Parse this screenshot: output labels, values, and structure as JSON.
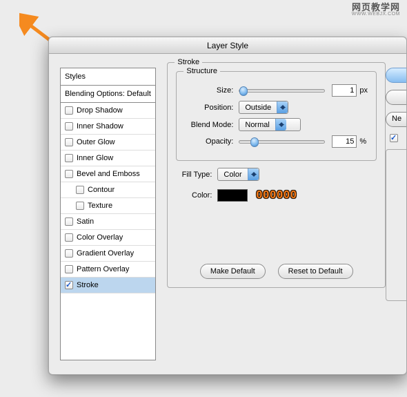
{
  "watermark": {
    "cn": "网页教学网",
    "en": "WWW.WEBJX.COM"
  },
  "dialog": {
    "title": "Layer Style",
    "sidebar": {
      "header": "Styles",
      "subheader": "Blending Options: Default",
      "items": [
        {
          "label": "Drop Shadow",
          "checked": false,
          "indent": false
        },
        {
          "label": "Inner Shadow",
          "checked": false,
          "indent": false
        },
        {
          "label": "Outer Glow",
          "checked": false,
          "indent": false
        },
        {
          "label": "Inner Glow",
          "checked": false,
          "indent": false
        },
        {
          "label": "Bevel and Emboss",
          "checked": false,
          "indent": false
        },
        {
          "label": "Contour",
          "checked": false,
          "indent": true
        },
        {
          "label": "Texture",
          "checked": false,
          "indent": true
        },
        {
          "label": "Satin",
          "checked": false,
          "indent": false
        },
        {
          "label": "Color Overlay",
          "checked": false,
          "indent": false
        },
        {
          "label": "Gradient Overlay",
          "checked": false,
          "indent": false
        },
        {
          "label": "Pattern Overlay",
          "checked": false,
          "indent": false
        },
        {
          "label": "Stroke",
          "checked": true,
          "indent": false,
          "selected": true
        }
      ]
    },
    "stroke": {
      "group_label": "Stroke",
      "structure_label": "Structure",
      "size": {
        "label": "Size:",
        "value": "1",
        "unit": "px",
        "thumb_pct": 0
      },
      "position": {
        "label": "Position:",
        "value": "Outside"
      },
      "blend": {
        "label": "Blend Mode:",
        "value": "Normal"
      },
      "opacity": {
        "label": "Opacity:",
        "value": "15",
        "unit": "%",
        "thumb_pct": 13
      },
      "filltype": {
        "label": "Fill Type:",
        "value": "Color"
      },
      "color": {
        "label": "Color:",
        "hex": "000000",
        "swatch": "#000000"
      },
      "buttons": {
        "default": "Make Default",
        "reset": "Reset to Default"
      }
    },
    "right": {
      "new_style": "Ne"
    }
  }
}
